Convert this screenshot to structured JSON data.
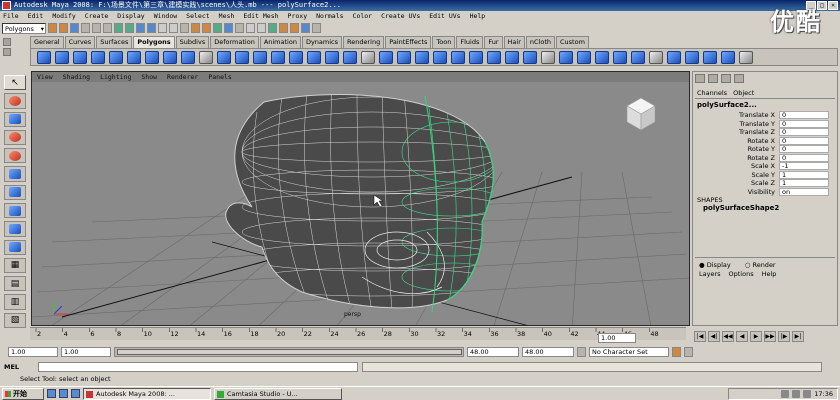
{
  "window": {
    "title": "Autodesk Maya 2008: F:\\场景文件\\第三章\\建模实践\\scenes\\人头.mb  ---  polySurface2..."
  },
  "watermark": "优酷",
  "menubar": [
    "File",
    "Edit",
    "Modify",
    "Create",
    "Display",
    "Window",
    "Select",
    "Mesh",
    "Edit Mesh",
    "Proxy",
    "Normals",
    "Color",
    "Create UVs",
    "Edit UVs",
    "Help"
  ],
  "statusline": {
    "mode": "Polygons"
  },
  "shelf_tabs": [
    "General",
    "Curves",
    "Surfaces",
    "Polygons",
    "Subdivs",
    "Deformation",
    "Animation",
    "Dynamics",
    "Rendering",
    "PaintEffects",
    "Toon",
    "Fluids",
    "Fur",
    "Hair",
    "nCloth",
    "Custom"
  ],
  "shelf_active": "Polygons",
  "viewport": {
    "menu": [
      "View",
      "Shading",
      "Lighting",
      "Show",
      "Renderer",
      "Panels"
    ],
    "camera_label": "persp"
  },
  "channel_box": {
    "tabs": [
      "Channels",
      "Object"
    ],
    "object_name": "polySurface2...",
    "attributes": [
      {
        "label": "Translate X",
        "value": "0"
      },
      {
        "label": "Translate Y",
        "value": "0"
      },
      {
        "label": "Translate Z",
        "value": "0"
      },
      {
        "label": "Rotate X",
        "value": "0"
      },
      {
        "label": "Rotate Y",
        "value": "0"
      },
      {
        "label": "Rotate Z",
        "value": "0"
      },
      {
        "label": "Scale X",
        "value": "-1"
      },
      {
        "label": "Scale Y",
        "value": "1"
      },
      {
        "label": "Scale Z",
        "value": "1"
      },
      {
        "label": "Visibility",
        "value": "on"
      }
    ],
    "shapes_header": "SHAPES",
    "shape_name": "polySurfaceShape2"
  },
  "layer_editor": {
    "radios": [
      "Display",
      "Render"
    ],
    "menu": [
      "Layers",
      "Options",
      "Help"
    ]
  },
  "timeline": {
    "ticks": [
      "2",
      "4",
      "6",
      "8",
      "10",
      "12",
      "14",
      "16",
      "18",
      "20",
      "22",
      "24",
      "26",
      "28",
      "30",
      "32",
      "34",
      "36",
      "38",
      "40",
      "42",
      "44",
      "46",
      "48"
    ],
    "current_frame": "1.00"
  },
  "range": {
    "start": "1.00",
    "start_inner": "1.00",
    "end_inner": "48.00",
    "end": "48.00",
    "character_set": "No Character Set"
  },
  "command_line": {
    "label": "MEL"
  },
  "help_line": "Select Tool: select an object",
  "taskbar": {
    "start_label": "开始",
    "tasks": [
      "Autodesk Maya 2008: ...",
      "Camtasia Studio - U..."
    ],
    "clock": "17:36"
  }
}
